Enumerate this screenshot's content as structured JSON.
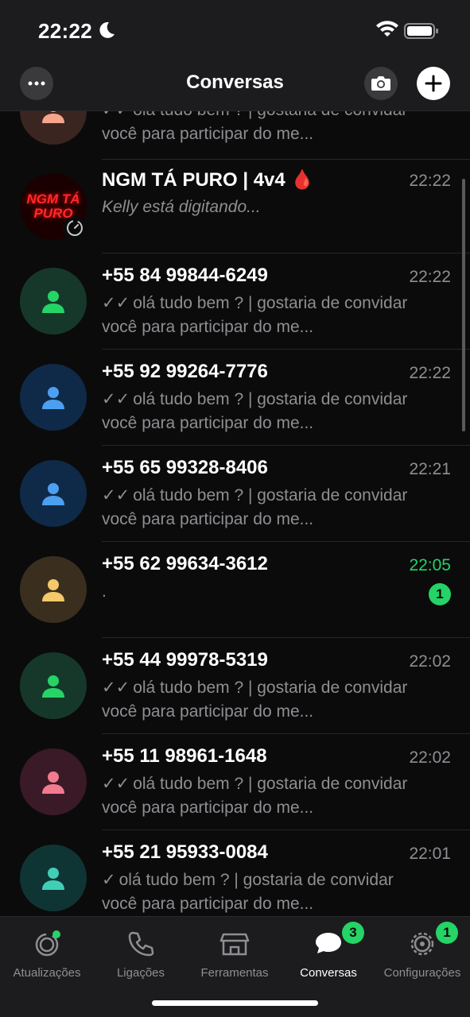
{
  "status_bar": {
    "time": "22:22"
  },
  "header": {
    "title": "Conversas"
  },
  "chats": [
    {
      "name": "",
      "time": "",
      "preview": "olá tudo bem ? | gostaria de convidar você para participar do me...",
      "ticks": "✓✓",
      "avatar_bg": "#3a2520",
      "avatar_fg": "#f4a58a"
    },
    {
      "name": "NGM TÁ PURO | 4v4 🩸",
      "time": "22:22",
      "preview": "Kelly está digitando...",
      "avatar_text": "NGM TÁ PURO"
    },
    {
      "name": "+55 84 99844-6249",
      "time": "22:22",
      "preview": "olá tudo bem ? | gostaria de convidar você para participar do me...",
      "ticks": "✓✓",
      "avatar_bg": "#16382a",
      "avatar_fg": "#25d366"
    },
    {
      "name": "+55 92 99264-7776",
      "time": "22:22",
      "preview": "olá tudo bem ? | gostaria de convidar você para participar do me...",
      "ticks": "✓✓",
      "avatar_bg": "#0f2a48",
      "avatar_fg": "#4d9ff0"
    },
    {
      "name": "+55 65 99328-8406",
      "time": "22:21",
      "preview": "olá tudo bem ? | gostaria de convidar você para participar do me...",
      "ticks": "✓✓",
      "avatar_bg": "#0f2a48",
      "avatar_fg": "#4d9ff0"
    },
    {
      "name": "+55 62 99634-3612",
      "time": "22:05",
      "preview": ".",
      "unread": "1",
      "avatar_bg": "#3a2f1e",
      "avatar_fg": "#f5c86a"
    },
    {
      "name": "+55 44 99978-5319",
      "time": "22:02",
      "preview": "olá tudo bem ? | gostaria de convidar você para participar do me...",
      "ticks": "✓✓",
      "avatar_bg": "#16382a",
      "avatar_fg": "#25d366"
    },
    {
      "name": "+55 11 98961-1648",
      "time": "22:02",
      "preview": "olá tudo bem ? | gostaria de convidar você para participar do me...",
      "ticks": "✓✓",
      "avatar_bg": "#3a1a26",
      "avatar_fg": "#f27a8f"
    },
    {
      "name": "+55 21 95933-0084",
      "time": "22:01",
      "preview": "olá tudo bem ? | gostaria de convidar você para participar do me...",
      "ticks": "✓",
      "avatar_bg": "#0f3434",
      "avatar_fg": "#3fcfb6"
    }
  ],
  "tabs": [
    {
      "label": "Atualizações",
      "icon": "updates-icon"
    },
    {
      "label": "Ligações",
      "icon": "phone-icon"
    },
    {
      "label": "Ferramentas",
      "icon": "store-icon"
    },
    {
      "label": "Conversas",
      "icon": "chats-icon",
      "badge": "3"
    },
    {
      "label": "Configurações",
      "icon": "settings-icon",
      "badge": "1"
    }
  ],
  "colors": {
    "accent": "#25d366",
    "background": "#0b0b0b",
    "bar": "#1c1c1e"
  }
}
